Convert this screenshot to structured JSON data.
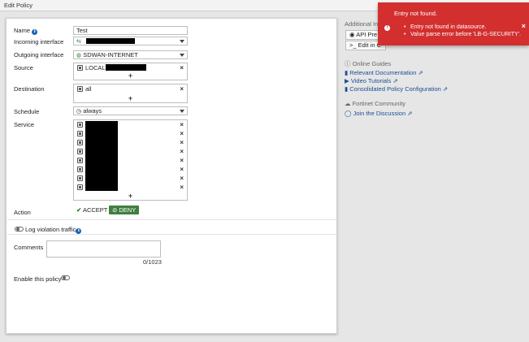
{
  "window": {
    "title": "Edit Policy"
  },
  "form": {
    "name": {
      "label": "Name",
      "value": "Test"
    },
    "incoming": {
      "label": "Incoming interface"
    },
    "outgoing": {
      "label": "Outgoing interface",
      "value": "SDWAN-INTERNET"
    },
    "source": {
      "label": "Source",
      "items": [
        "LOCAL"
      ]
    },
    "destination": {
      "label": "Destination",
      "items": [
        "all"
      ]
    },
    "schedule": {
      "label": "Schedule",
      "value": "always"
    },
    "service": {
      "label": "Service",
      "item_count": 8
    },
    "action": {
      "label": "Action",
      "accept": "ACCEPT",
      "deny": "DENY",
      "selected": "DENY"
    },
    "log_violation": {
      "label": "Log violation traffic"
    },
    "comments": {
      "label": "Comments",
      "counter": "0/1023"
    },
    "enable": {
      "label": "Enable this policy"
    }
  },
  "sidebar": {
    "additional_heading": "Additional In",
    "api_preview": "API Pre",
    "edit_cli": "Edit in C",
    "online_guides": "Online Guides",
    "guides": [
      "Relevant Documentation",
      "Video Tutorials",
      "Consolidated Policy Configuration"
    ],
    "community": "Fortinet Community",
    "join": "Join the Discussion"
  },
  "toast": {
    "title": "Entry not found.",
    "messages": [
      "Entry not found in datasource.",
      "Value parse error before 'LB-G-SECURITY'."
    ],
    "close": "×"
  },
  "icons": {
    "plus": "+",
    "remove": "×"
  },
  "colors": {
    "accept": "#2e7d32",
    "deny_bg": "#3f7f3f",
    "toast_bg": "#d32f2f",
    "link": "#1a4f96"
  }
}
